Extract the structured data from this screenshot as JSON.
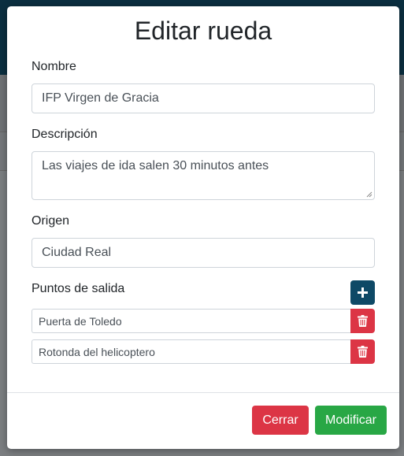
{
  "modal": {
    "title": "Editar rueda",
    "fields": {
      "nombre": {
        "label": "Nombre",
        "value": "IFP Virgen de Gracia"
      },
      "descripcion": {
        "label": "Descripción",
        "value": "Las viajes de ida salen 30 minutos antes"
      },
      "origen": {
        "label": "Origen",
        "value": "Ciudad Real"
      }
    },
    "puntos": {
      "label": "Puntos de salida",
      "items": [
        {
          "value": "Puerta de Toledo"
        },
        {
          "value": "Rotonda del helicoptero"
        }
      ]
    },
    "footer": {
      "close_label": "Cerrar",
      "submit_label": "Modificar"
    }
  },
  "colors": {
    "primary": "#0e4966",
    "danger": "#dc3545",
    "success": "#28a745",
    "header": "#0b2f40"
  },
  "icons": {
    "add": "plus-icon",
    "delete": "trash-icon"
  }
}
